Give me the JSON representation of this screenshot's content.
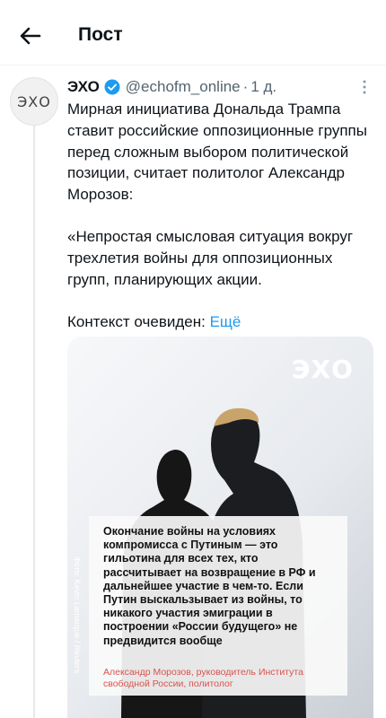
{
  "header": {
    "title": "Пост",
    "back_icon": "arrow-left-icon"
  },
  "post": {
    "avatar_text": "ЭХО",
    "author_name": "ЭХО",
    "handle": "@echofm_online",
    "separator": "·",
    "time": "1 д.",
    "paragraph1": "Мирная инициатива Дональда Трампа ставит российские оппозиционные группы перед сложным выбором политической позиции, считает политолог Александр Морозов:",
    "paragraph2": "«Непростая смысловая ситуация вокруг трехлетия войны для оппозиционных групп, планирующих акции.",
    "paragraph3_prefix": "Контекст очевиден: ",
    "more_label": "Ещё",
    "colors": {
      "link": "#1d9bf0",
      "verified": "#1d9bf0",
      "muted": "#536471"
    }
  },
  "media": {
    "logo": "ЭХО",
    "quote": "Окончание войны на условиях компромисса с Путиным — это гильотина для всех тех, кто рассчитывает на возвращение в РФ и дальнейшее участие в чем-то. Если Путин выскальзывает из войны, то никакого участия эмиграции в построении «России будущего» не предвидится вообще",
    "quote_author": "Александр Морозов, руководитель Института свободной России, политолог",
    "photo_credit": "Фото: Kevin Lamarque / Reuters"
  }
}
